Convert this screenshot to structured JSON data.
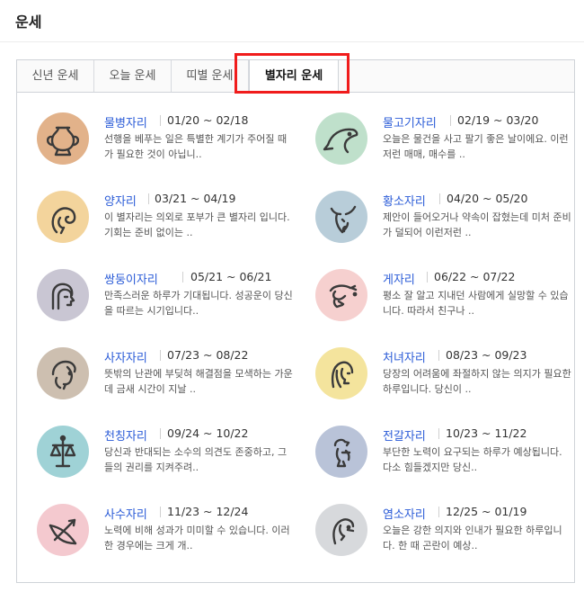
{
  "header": {
    "title": "운세"
  },
  "tabs": [
    {
      "label": "신년 운세"
    },
    {
      "label": "오늘 운세"
    },
    {
      "label": "띠별 운세"
    },
    {
      "label": "별자리 운세"
    }
  ],
  "zodiac": [
    {
      "name": "물병자리",
      "date": "01/20 ~ 02/18",
      "desc": "선행을 베푸는 일은 특별한 계기가 주어질 때가 필요한 것이 아닙니..",
      "icon": "aquarius-icon",
      "color": "#e2b28a"
    },
    {
      "name": "물고기자리",
      "date": "02/19 ~ 03/20",
      "desc": "오늘은 물건을 사고 팔기 좋은 날이에요. 이런 저런 매매, 매수를 ..",
      "icon": "pisces-icon",
      "color": "#bfe0cb"
    },
    {
      "name": "양자리",
      "date": "03/21 ~ 04/19",
      "desc": "이 별자리는 의외로 포부가 큰 별자리 입니다. 기회는 준비 없이는 ..",
      "icon": "aries-icon",
      "color": "#f3d49c"
    },
    {
      "name": "황소자리",
      "date": "04/20 ~ 05/20",
      "desc": "제안이 들어오거나 약속이 잡혔는데 미처 준비가 덜되어 이런저런 ..",
      "icon": "taurus-icon",
      "color": "#b8cdd9"
    },
    {
      "name": "쌍둥이자리",
      "date": "05/21 ~ 06/21",
      "desc": "만족스러운 하루가 기대됩니다. 성공운이 당신을 따르는 시기입니다..",
      "icon": "gemini-icon",
      "color": "#c9c6d3"
    },
    {
      "name": "게자리",
      "date": "06/22 ~ 07/22",
      "desc": "평소 잘 알고 지내던 사람에게 실망할 수 있습니다. 따라서 친구나 ..",
      "icon": "cancer-icon",
      "color": "#f6d0cf"
    },
    {
      "name": "사자자리",
      "date": "07/23 ~ 08/22",
      "desc": "뜻밖의 난관에 부딪혀 해결점을 모색하는 가운데 금새 시간이 지날 ..",
      "icon": "leo-icon",
      "color": "#cdbfb0"
    },
    {
      "name": "처녀자리",
      "date": "08/23 ~ 09/23",
      "desc": "당장의 어려움에 좌절하지 않는 의지가 필요한 하루입니다. 당신이 ..",
      "icon": "virgo-icon",
      "color": "#f4e49d"
    },
    {
      "name": "천칭자리",
      "date": "09/24 ~ 10/22",
      "desc": "당신과 반대되는 소수의 의견도 존중하고, 그들의 권리를 지켜주려..",
      "icon": "libra-icon",
      "color": "#9fd2d6"
    },
    {
      "name": "전갈자리",
      "date": "10/23 ~ 11/22",
      "desc": "부단한 노력이 요구되는 하루가 예상됩니다. 다소 힘들겠지만 당신..",
      "icon": "scorpio-icon",
      "color": "#b9c3d8"
    },
    {
      "name": "사수자리",
      "date": "11/23 ~ 12/24",
      "desc": "노력에 비해 성과가 미미할 수 있습니다. 이러한 경우에는 크게 개..",
      "icon": "sagittarius-icon",
      "color": "#f4c9cf"
    },
    {
      "name": "염소자리",
      "date": "12/25 ~ 01/19",
      "desc": "오늘은 강한 의지와 인내가 필요한 하루입니다. 한 때 곤란이 예상..",
      "icon": "capricorn-icon",
      "color": "#d7d9dc"
    }
  ]
}
